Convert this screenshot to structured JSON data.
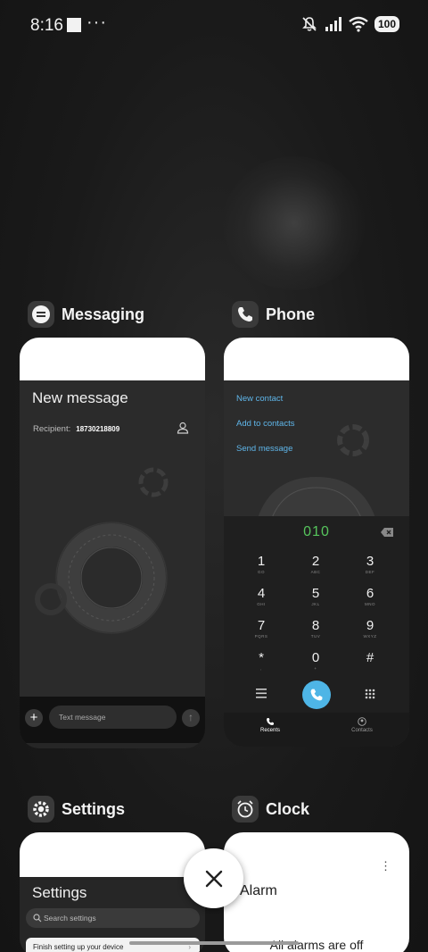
{
  "status_bar": {
    "time": "8:16",
    "dots": "···",
    "battery": "100"
  },
  "recents": [
    {
      "app": "Messaging"
    },
    {
      "app": "Phone"
    },
    {
      "app": "Settings"
    },
    {
      "app": "Clock"
    }
  ],
  "messaging": {
    "title": "New message",
    "recipient_label": "Recipient:",
    "recipient_number": "18730218809",
    "plus": "+",
    "input_placeholder": "Text message",
    "send": "↑"
  },
  "phone": {
    "links": [
      "New contact",
      "Add to contacts",
      "Send message"
    ],
    "dialed": "010",
    "keys": [
      {
        "d": "1",
        "l": "GO"
      },
      {
        "d": "2",
        "l": "ABC"
      },
      {
        "d": "3",
        "l": "DEF"
      },
      {
        "d": "4",
        "l": "GHI"
      },
      {
        "d": "5",
        "l": "JKL"
      },
      {
        "d": "6",
        "l": "MNO"
      },
      {
        "d": "7",
        "l": "PQRS"
      },
      {
        "d": "8",
        "l": "TUV"
      },
      {
        "d": "9",
        "l": "WXYZ"
      },
      {
        "d": "*",
        "l": ","
      },
      {
        "d": "0",
        "l": "+"
      },
      {
        "d": "#",
        "l": ""
      }
    ],
    "accent": "#4eb5e6",
    "dial_color": "#56c45c",
    "nav": {
      "recents": "Recents",
      "contacts": "Contacts"
    }
  },
  "settings": {
    "title": "Settings",
    "search_placeholder": "Search settings",
    "row": "Finish setting up your device",
    "chevron": "›"
  },
  "clock": {
    "title": "Alarm",
    "more": "⋮",
    "empty": "All alarms are off"
  }
}
